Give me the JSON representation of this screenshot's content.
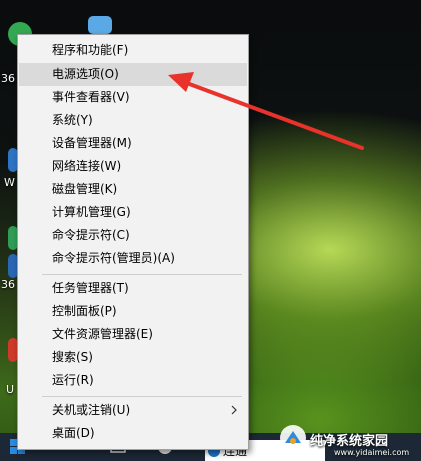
{
  "menu": {
    "items": [
      {
        "label": "程序和功能(F)"
      },
      {
        "label": "电源选项(O)"
      },
      {
        "label": "事件查看器(V)"
      },
      {
        "label": "系统(Y)"
      },
      {
        "label": "设备管理器(M)"
      },
      {
        "label": "网络连接(W)"
      },
      {
        "label": "磁盘管理(K)"
      },
      {
        "label": "计算机管理(G)"
      },
      {
        "label": "命令提示符(C)"
      },
      {
        "label": "命令提示符(管理员)(A)"
      },
      {
        "label": "任务管理器(T)"
      },
      {
        "label": "控制面板(P)"
      },
      {
        "label": "文件资源管理器(E)"
      },
      {
        "label": "搜索(S)"
      },
      {
        "label": "运行(R)"
      },
      {
        "label": "关机或注销(U)"
      },
      {
        "label": "桌面(D)"
      }
    ],
    "highlighted_index": 1
  },
  "desktop": {
    "labels": [
      "36",
      "W",
      "36",
      "U"
    ]
  },
  "taskbar": {
    "search_text": "连通"
  },
  "watermark": {
    "title": "纯净系统家园",
    "url": "www.yidaimei.com"
  },
  "colors": {
    "annotation_arrow": "#e8322b",
    "menu_background": "#f2f2f2",
    "hover_background": "#dadada"
  }
}
